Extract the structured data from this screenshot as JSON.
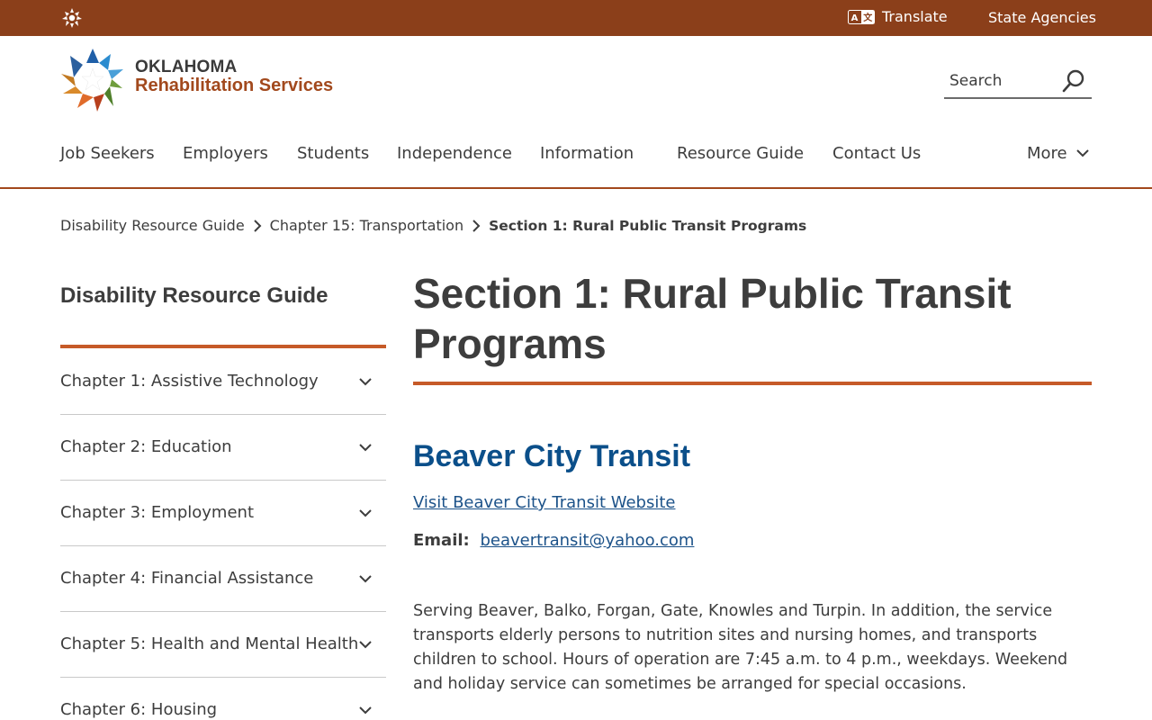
{
  "topbar": {
    "translate_label": "Translate",
    "agencies_label": "State Agencies"
  },
  "brand": {
    "line1": "OKLAHOMA",
    "line2": "Rehabilitation Services"
  },
  "search": {
    "placeholder": "Search"
  },
  "nav": {
    "items": [
      "Job Seekers",
      "Employers",
      "Students",
      "Independence",
      "Information",
      "Resource Guide",
      "Contact Us"
    ],
    "more_label": "More"
  },
  "breadcrumb": {
    "items": [
      "Disability Resource Guide",
      "Chapter 15: Transportation"
    ],
    "current": "Section 1: Rural Public Transit Programs"
  },
  "sidebar": {
    "title": "Disability Resource Guide",
    "items": [
      {
        "label": "Chapter 1: Assistive Technology"
      },
      {
        "label": "Chapter 2: Education"
      },
      {
        "label": "Chapter 3: Employment"
      },
      {
        "label": "Chapter 4: Financial Assistance"
      },
      {
        "label": "Chapter 5: Health and Mental Health"
      },
      {
        "label": "Chapter 6: Housing"
      }
    ]
  },
  "main": {
    "title": "Section 1: Rural Public Transit Programs",
    "entry": {
      "heading": "Beaver City Transit",
      "website_link": "Visit Beaver City Transit Website",
      "email_label": "Email:",
      "email": "beavertransit@yahoo.com",
      "description": "Serving Beaver, Balko, Forgan, Gate, Knowles and Turpin. In addition, the service transports elderly persons to nutrition sites and nursing homes, and transports children to school. Hours of operation are 7:45 a.m. to 4 p.m., weekdays. Weekend and holiday service can sometimes be arranged for special occasions."
    }
  },
  "colors": {
    "topbar": "#8b3f1a",
    "accent": "#c65a28",
    "link": "#1c5289",
    "heading_blue": "#0b4f8a"
  }
}
